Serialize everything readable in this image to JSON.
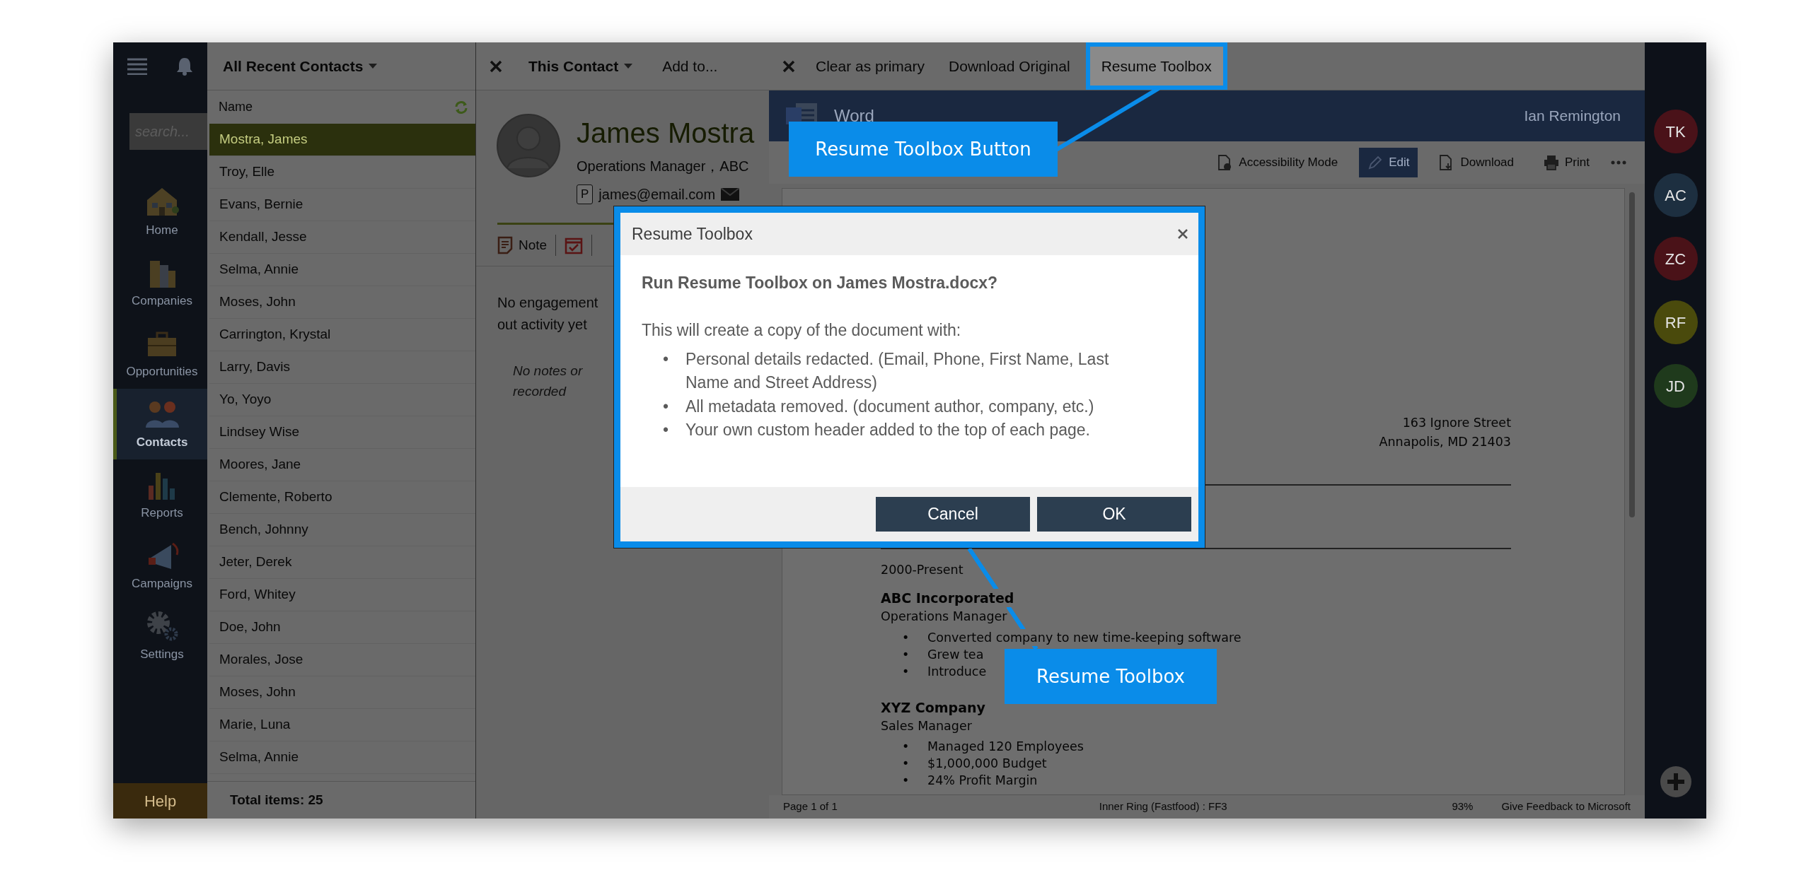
{
  "nav": {
    "search": {
      "placeholder": "search..."
    },
    "items": [
      {
        "label": "Home",
        "kind": "home",
        "selected": false
      },
      {
        "label": "Companies",
        "kind": "companies",
        "selected": false
      },
      {
        "label": "Opportunities",
        "kind": "opportunities",
        "selected": false
      },
      {
        "label": "Contacts",
        "kind": "contacts",
        "selected": true
      },
      {
        "label": "Reports",
        "kind": "reports",
        "selected": false
      },
      {
        "label": "Campaigns",
        "kind": "campaigns",
        "selected": false
      },
      {
        "label": "Settings",
        "kind": "settings",
        "selected": false
      }
    ],
    "help": "Help"
  },
  "contacts": {
    "title": "All Recent Contacts",
    "column": "Name",
    "rows": [
      {
        "name": "Mostra, James",
        "selected": true
      },
      {
        "name": "Troy, Elle",
        "selected": false
      },
      {
        "name": "Evans, Bernie",
        "selected": false
      },
      {
        "name": "Kendall, Jesse",
        "selected": false
      },
      {
        "name": "Selma, Annie",
        "selected": false
      },
      {
        "name": "Moses, John",
        "selected": false
      },
      {
        "name": "Carrington, Krystal",
        "selected": false
      },
      {
        "name": "Larry, Davis",
        "selected": false
      },
      {
        "name": "Yo, Yoyo",
        "selected": false
      },
      {
        "name": "Lindsey Wise",
        "selected": false
      },
      {
        "name": "Moores, Jane",
        "selected": false
      },
      {
        "name": "Clemente, Roberto",
        "selected": false
      },
      {
        "name": "Bench, Johnny",
        "selected": false
      },
      {
        "name": "Jeter, Derek",
        "selected": false
      },
      {
        "name": "Ford, Whitey",
        "selected": false
      },
      {
        "name": "Doe, John",
        "selected": false
      },
      {
        "name": "Morales, Jose",
        "selected": false
      },
      {
        "name": "Moses, John",
        "selected": false
      },
      {
        "name": "Marie, Luna",
        "selected": false
      },
      {
        "name": "Selma, Annie",
        "selected": false
      }
    ],
    "footer": "Total items: 25"
  },
  "contact": {
    "scope": "This Contact",
    "add": "Add to...",
    "name": "James Mostra",
    "title": "Operations Manager，ABC",
    "email_badge": "P",
    "email": "james@email.com",
    "note_tab": "Note",
    "engagement": [
      "No engagement",
      "out activity yet"
    ],
    "notes": [
      "No notes or",
      "recorded"
    ]
  },
  "document": {
    "toolbar": [
      {
        "label": "Clear as primary",
        "highlighted": false
      },
      {
        "label": "Download Original",
        "highlighted": false
      },
      {
        "label": "Resume Toolbox",
        "highlighted": true
      }
    ],
    "app": "Word",
    "user": "Ian Remington",
    "tools": [
      {
        "label": "Accessibility Mode",
        "kind": "accessibility",
        "selected": false
      },
      {
        "label": "Edit",
        "kind": "edit",
        "selected": true
      },
      {
        "label": "Download",
        "kind": "download",
        "selected": false
      },
      {
        "label": "Print",
        "kind": "print",
        "selected": false
      }
    ],
    "bullet_marker": "•",
    "address": [
      "163 Ignore Street",
      "Annapolis, MD 21403"
    ],
    "period": "2000-Present",
    "jobs": [
      {
        "company": "ABC Incorporated",
        "title": "Operations Manager",
        "bullets": [
          "Converted company to new time-keeping software",
          "Grew tea",
          "Introduce"
        ]
      },
      {
        "company": "XYZ Company",
        "title": "Sales Manager",
        "bullets": [
          "Managed 120 Employees",
          "$1,000,000 Budget",
          "24% Profit Margin"
        ]
      }
    ],
    "status": {
      "page": "Page 1 of 1",
      "ring": "Inner Ring (Fastfood) : FF3",
      "zoom": "93%",
      "feedback": "Give Feedback to Microsoft"
    }
  },
  "rail": {
    "avatars": [
      {
        "initials": "TK",
        "color": "#4a1219"
      },
      {
        "initials": "AC",
        "color": "#1d2f40"
      },
      {
        "initials": "ZC",
        "color": "#4a1218"
      },
      {
        "initials": "RF",
        "color": "#4a4a0c"
      },
      {
        "initials": "JD",
        "color": "#1f3a1c"
      }
    ]
  },
  "dialog": {
    "title": "Resume Toolbox",
    "question": "Run Resume Toolbox on James Mostra.docx?",
    "intro": "This will create a copy of the document with:",
    "bullet_marker": "•",
    "bullets": [
      "Personal details redacted. (Email, Phone, First Name, Last Name and Street Address)",
      "All metadata removed. (document author, company, etc.)",
      "Your own custom header added to the top of each page."
    ],
    "buttons": [
      "Cancel",
      "OK"
    ]
  },
  "callouts": [
    "Resume Toolbox Button",
    "Resume Toolbox"
  ]
}
